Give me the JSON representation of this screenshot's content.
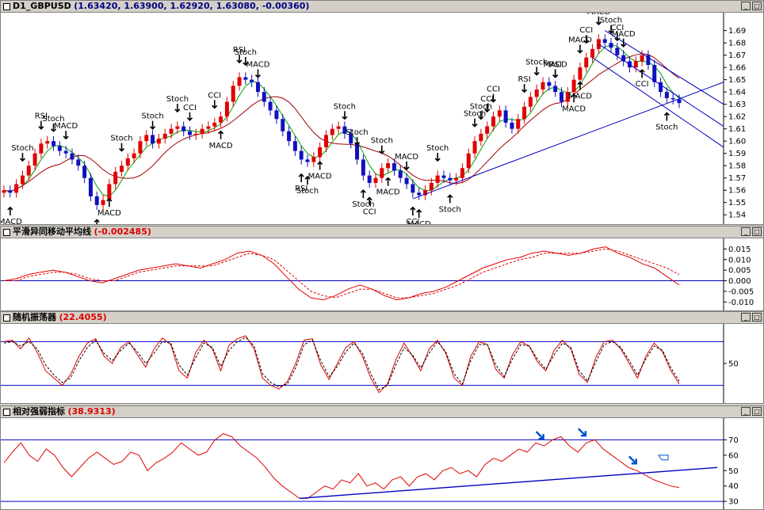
{
  "colors": {
    "up": "#e00000",
    "down": "#1010c0",
    "neutral": "#00c000",
    "ma_fast": "#00a000",
    "ma_slow": "#a00000",
    "line": "#0000c0",
    "signal": "#000000",
    "bg": "#ffffff",
    "titlebar": "#d4d0c8"
  },
  "window_buttons": {
    "minimize": "_",
    "maximize": "□"
  },
  "panes": [
    {
      "id": "price",
      "name": "D1_GBPUSD",
      "values": "(1.63420, 1.63900, 1.62920, 1.63080, -0.00360)"
    },
    {
      "id": "macd",
      "name": "平滑异同移动平均线",
      "values": "(-0.002485)"
    },
    {
      "id": "stoch",
      "name": "随机振荡器",
      "values": "(22.4055)"
    },
    {
      "id": "rsi",
      "name": "相对强弱指标",
      "values": "(38.9313)"
    }
  ],
  "chart_data": [
    {
      "type": "candlestick",
      "title": "D1_GBPUSD",
      "ylim": [
        1.535,
        1.702
      ],
      "yticks": [
        1.54,
        1.55,
        1.56,
        1.57,
        1.58,
        1.59,
        1.6,
        1.61,
        1.62,
        1.63,
        1.64,
        1.65,
        1.66,
        1.67,
        1.68,
        1.69
      ],
      "ytick_labels": [
        "1.54",
        "1.55",
        "1.56",
        "1.57",
        "1.58",
        "1.59",
        "1.60",
        "1.61",
        "1.62",
        "1.63",
        "1.64",
        "1.65",
        "1.66",
        "1.67",
        "1.68",
        "1.69"
      ],
      "close_series": [
        1.56,
        1.558,
        1.565,
        1.572,
        1.58,
        1.59,
        1.598,
        1.6,
        1.596,
        1.592,
        1.59,
        1.585,
        1.58,
        1.57,
        1.555,
        1.548,
        1.552,
        1.565,
        1.575,
        1.58,
        1.586,
        1.59,
        1.6,
        1.605,
        1.598,
        1.602,
        1.606,
        1.61,
        1.612,
        1.608,
        1.605,
        1.606,
        1.61,
        1.612,
        1.615,
        1.62,
        1.632,
        1.645,
        1.652,
        1.65,
        1.648,
        1.64,
        1.632,
        1.625,
        1.618,
        1.608,
        1.6,
        1.592,
        1.585,
        1.583,
        1.587,
        1.595,
        1.605,
        1.61,
        1.612,
        1.606,
        1.598,
        1.585,
        1.572,
        1.566,
        1.57,
        1.578,
        1.582,
        1.576,
        1.57,
        1.565,
        1.558,
        1.556,
        1.56,
        1.566,
        1.572,
        1.57,
        1.568,
        1.57,
        1.578,
        1.59,
        1.6,
        1.606,
        1.612,
        1.62,
        1.625,
        1.615,
        1.61,
        1.618,
        1.628,
        1.636,
        1.642,
        1.648,
        1.645,
        1.64,
        1.632,
        1.64,
        1.65,
        1.66,
        1.668,
        1.675,
        1.683,
        1.68,
        1.676,
        1.67,
        1.665,
        1.66,
        1.665,
        1.67,
        1.662,
        1.648,
        1.64,
        1.635,
        1.634,
        1.631
      ],
      "signals": [
        {
          "label": "MACD",
          "dir": "up",
          "i": 1
        },
        {
          "label": "Stoch",
          "dir": "down",
          "i": 3
        },
        {
          "label": "RSI",
          "dir": "down",
          "i": 6
        },
        {
          "label": "Stoch",
          "dir": "down",
          "i": 8
        },
        {
          "label": "MACD",
          "dir": "down",
          "i": 10
        },
        {
          "label": "MACD",
          "dir": "up",
          "i": 17
        },
        {
          "label": "Stoch",
          "dir": "up",
          "i": 15
        },
        {
          "label": "Stoch",
          "dir": "down",
          "i": 19
        },
        {
          "label": "Stoch",
          "dir": "down",
          "i": 24
        },
        {
          "label": "Stoch",
          "dir": "down",
          "i": 28
        },
        {
          "label": "CCI",
          "dir": "down",
          "i": 30
        },
        {
          "label": "CCI",
          "dir": "down",
          "i": 34
        },
        {
          "label": "MACD",
          "dir": "up",
          "i": 35
        },
        {
          "label": "RSI",
          "dir": "down",
          "i": 38
        },
        {
          "label": "Stoch",
          "dir": "down",
          "i": 39
        },
        {
          "label": "MACD",
          "dir": "down",
          "i": 41
        },
        {
          "label": "Stoch",
          "dir": "down",
          "i": 55
        },
        {
          "label": "Stoch",
          "dir": "down",
          "i": 57
        },
        {
          "label": "RSI",
          "dir": "up",
          "i": 48
        },
        {
          "label": "Stoch",
          "dir": "up",
          "i": 49
        },
        {
          "label": "MACD",
          "dir": "up",
          "i": 51
        },
        {
          "label": "Stoch",
          "dir": "down",
          "i": 61
        },
        {
          "label": "CCI",
          "dir": "up",
          "i": 59
        },
        {
          "label": "Stoch",
          "dir": "up",
          "i": 58
        },
        {
          "label": "MACD",
          "dir": "up",
          "i": 62
        },
        {
          "label": "MACD",
          "dir": "down",
          "i": 65
        },
        {
          "label": "CCI",
          "dir": "up",
          "i": 66
        },
        {
          "label": "MACD",
          "dir": "up",
          "i": 67
        },
        {
          "label": "Stoch",
          "dir": "down",
          "i": 70
        },
        {
          "label": "Stoch",
          "dir": "up",
          "i": 72
        },
        {
          "label": "Stoch",
          "dir": "down",
          "i": 76
        },
        {
          "label": "Stoch",
          "dir": "down",
          "i": 77
        },
        {
          "label": "CCI",
          "dir": "down",
          "i": 78
        },
        {
          "label": "CCI",
          "dir": "down",
          "i": 79
        },
        {
          "label": "RSI",
          "dir": "down",
          "i": 84
        },
        {
          "label": "Stoch",
          "dir": "down",
          "i": 86
        },
        {
          "label": "RSI",
          "dir": "down",
          "i": 89
        },
        {
          "label": "MACD",
          "dir": "down",
          "i": 89
        },
        {
          "label": "MACD",
          "dir": "up",
          "i": 92
        },
        {
          "label": "MACD",
          "dir": "up",
          "i": 93
        },
        {
          "label": "MACD",
          "dir": "down",
          "i": 93
        },
        {
          "label": "CCI",
          "dir": "down",
          "i": 94
        },
        {
          "label": "MACD",
          "dir": "down",
          "i": 96
        },
        {
          "label": "Stoch",
          "dir": "down",
          "i": 98
        },
        {
          "label": "CCI",
          "dir": "down",
          "i": 99
        },
        {
          "label": "MACD",
          "dir": "down",
          "i": 100
        },
        {
          "label": "CCI",
          "dir": "up",
          "i": 103
        },
        {
          "label": "Stoch",
          "dir": "up",
          "i": 107
        }
      ]
    },
    {
      "type": "line",
      "title": "平滑异同移动平均线",
      "ylim": [
        -0.0125,
        0.0185
      ],
      "yticks": [
        -0.01,
        -0.005,
        0,
        0.005,
        0.01,
        0.015
      ],
      "ytick_labels": [
        "-0.010",
        "-0.005",
        "0.000",
        "0.005",
        "0.010",
        "0.015"
      ],
      "series": [
        {
          "values": [
            0.0,
            0.001,
            0.003,
            0.004,
            0.005,
            0.004,
            0.002,
            0.0,
            -0.001,
            0.001,
            0.003,
            0.005,
            0.006,
            0.007,
            0.008,
            0.007,
            0.006,
            0.008,
            0.01,
            0.013,
            0.014,
            0.012,
            0.008,
            0.002,
            -0.004,
            -0.008,
            -0.009,
            -0.007,
            -0.004,
            -0.002,
            -0.004,
            -0.007,
            -0.009,
            -0.008,
            -0.006,
            -0.005,
            -0.003,
            0.0,
            0.003,
            0.006,
            0.008,
            0.01,
            0.011,
            0.013,
            0.014,
            0.013,
            0.012,
            0.013,
            0.015,
            0.016,
            0.013,
            0.011,
            0.008,
            0.006,
            0.002,
            -0.002
          ]
        },
        {
          "values": [
            0.0,
            0.0,
            0.002,
            0.003,
            0.004,
            0.004,
            0.003,
            0.001,
            0.0,
            0.0,
            0.002,
            0.004,
            0.005,
            0.006,
            0.007,
            0.007,
            0.007,
            0.007,
            0.009,
            0.011,
            0.013,
            0.012,
            0.01,
            0.005,
            0.0,
            -0.005,
            -0.007,
            -0.008,
            -0.006,
            -0.004,
            -0.004,
            -0.006,
            -0.008,
            -0.008,
            -0.007,
            -0.006,
            -0.004,
            -0.002,
            0.001,
            0.004,
            0.006,
            0.008,
            0.01,
            0.011,
            0.013,
            0.013,
            0.013,
            0.013,
            0.014,
            0.015,
            0.014,
            0.012,
            0.01,
            0.008,
            0.006,
            0.003
          ]
        }
      ],
      "hlines": [
        0
      ]
    },
    {
      "type": "line",
      "title": "随机振荡器",
      "ylim": [
        0,
        100
      ],
      "yticks": [
        50
      ],
      "ytick_labels": [
        "50"
      ],
      "series": [
        {
          "values": [
            80,
            82,
            70,
            85,
            65,
            40,
            30,
            20,
            35,
            60,
            78,
            84,
            60,
            50,
            72,
            80,
            62,
            45,
            70,
            85,
            76,
            40,
            30,
            65,
            82,
            70,
            40,
            75,
            84,
            88,
            70,
            30,
            20,
            15,
            25,
            50,
            82,
            84,
            48,
            28,
            50,
            72,
            80,
            60,
            30,
            10,
            22,
            55,
            78,
            60,
            40,
            70,
            82,
            64,
            30,
            20,
            60,
            80,
            76,
            42,
            30,
            62,
            80,
            74,
            52,
            40,
            68,
            82,
            70,
            35,
            24,
            58,
            80,
            82,
            70,
            50,
            30,
            60,
            78,
            66,
            40,
            22
          ]
        },
        {
          "values": [
            78,
            80,
            74,
            80,
            70,
            48,
            34,
            24,
            30,
            54,
            72,
            82,
            64,
            54,
            68,
            78,
            66,
            50,
            64,
            80,
            78,
            48,
            34,
            58,
            78,
            72,
            46,
            68,
            80,
            86,
            74,
            36,
            24,
            18,
            22,
            44,
            76,
            82,
            54,
            32,
            46,
            66,
            78,
            64,
            36,
            14,
            20,
            48,
            72,
            62,
            44,
            64,
            80,
            66,
            36,
            22,
            54,
            76,
            76,
            48,
            32,
            56,
            76,
            74,
            56,
            42,
            62,
            78,
            72,
            40,
            26,
            52,
            76,
            80,
            72,
            54,
            34,
            56,
            74,
            68,
            44,
            26
          ]
        }
      ],
      "hlines": [
        80,
        20
      ]
    },
    {
      "type": "line",
      "title": "相对强弱指标",
      "ylim": [
        27,
        82
      ],
      "yticks": [
        30,
        40,
        50,
        60,
        70
      ],
      "ytick_labels": [
        "30",
        "40",
        "50",
        "60",
        "70"
      ],
      "series": [
        {
          "values": [
            55,
            62,
            68,
            60,
            56,
            64,
            60,
            52,
            46,
            52,
            58,
            62,
            58,
            54,
            56,
            62,
            60,
            50,
            55,
            58,
            62,
            68,
            64,
            60,
            62,
            70,
            74,
            72,
            66,
            62,
            58,
            52,
            45,
            40,
            36,
            32,
            32,
            36,
            40,
            38,
            44,
            42,
            48,
            40,
            42,
            38,
            44,
            46,
            40,
            46,
            48,
            44,
            50,
            52,
            48,
            50,
            46,
            54,
            58,
            56,
            60,
            64,
            62,
            68,
            66,
            70,
            72,
            66,
            62,
            68,
            70,
            64,
            60,
            56,
            52,
            50,
            47,
            44,
            42,
            40,
            39
          ]
        }
      ],
      "hlines": [
        70,
        30
      ]
    }
  ]
}
